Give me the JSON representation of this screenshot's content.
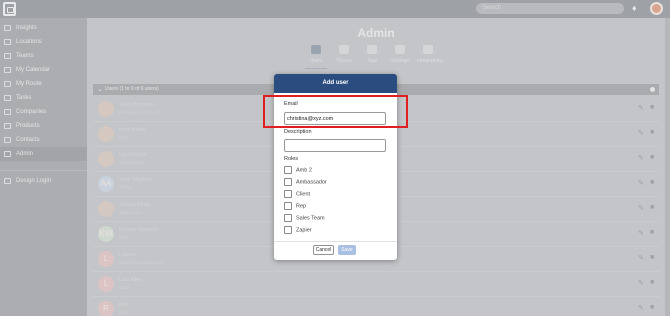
{
  "topbar": {
    "search_placeholder": "Search"
  },
  "sidebar": {
    "items": [
      {
        "label": "Insights",
        "icon": "chart-icon"
      },
      {
        "label": "Locations",
        "icon": "map-pin-icon"
      },
      {
        "label": "Teams",
        "icon": "people-icon"
      },
      {
        "label": "My Calendar",
        "icon": "calendar-icon"
      },
      {
        "label": "My Route",
        "icon": "route-icon"
      },
      {
        "label": "Tasks",
        "icon": "checklist-icon"
      },
      {
        "label": "Companies",
        "icon": "building-icon"
      },
      {
        "label": "Products",
        "icon": "box-icon"
      },
      {
        "label": "Contacts",
        "icon": "contact-icon"
      },
      {
        "label": "Admin",
        "icon": "gear-icon"
      }
    ],
    "footer_item": "Design Login"
  },
  "main": {
    "title": "Admin",
    "tabs": [
      "Users",
      "Places",
      "Tags",
      "Settings",
      "Integrations"
    ],
    "list_header": "Users (1 to 9 of 9 users)",
    "rows": [
      {
        "initial": "",
        "name": "Trent Brannon",
        "sub": "trent@company.com"
      },
      {
        "initial": "",
        "name": "Irwin Kiera",
        "sub": "Rep"
      },
      {
        "initial": "",
        "name": "Ian Kreisler",
        "sub": "Ambassador"
      },
      {
        "initial": "AA",
        "name": "Jack Whitford",
        "sub": "Client"
      },
      {
        "initial": "",
        "name": "Jordan Eliza",
        "sub": "Sales Team"
      },
      {
        "initial": "KW",
        "name": "Kristen Williams",
        "sub": "Rep"
      },
      {
        "initial": "L",
        "name": "Lauren",
        "sub": "lauren@company.com"
      },
      {
        "initial": "L",
        "name": "Lisa Allen",
        "sub": "Client"
      },
      {
        "initial": "R",
        "name": "Ryo",
        "sub": "Rep"
      }
    ]
  },
  "modal": {
    "title": "Add user",
    "email_label": "Email",
    "email_value": "christina@xyz.com",
    "description_label": "Description",
    "description_value": "",
    "roles_label": "Roles",
    "roles": [
      "Amb 2",
      "Ambassador",
      "Client",
      "Rep",
      "Sales Team",
      "Zapier"
    ],
    "cancel_label": "Cancel",
    "save_label": "Save"
  },
  "colors": {
    "modal_header": "#2b4c7e",
    "save_button": "#aac0e2",
    "highlight": "#e02020"
  }
}
